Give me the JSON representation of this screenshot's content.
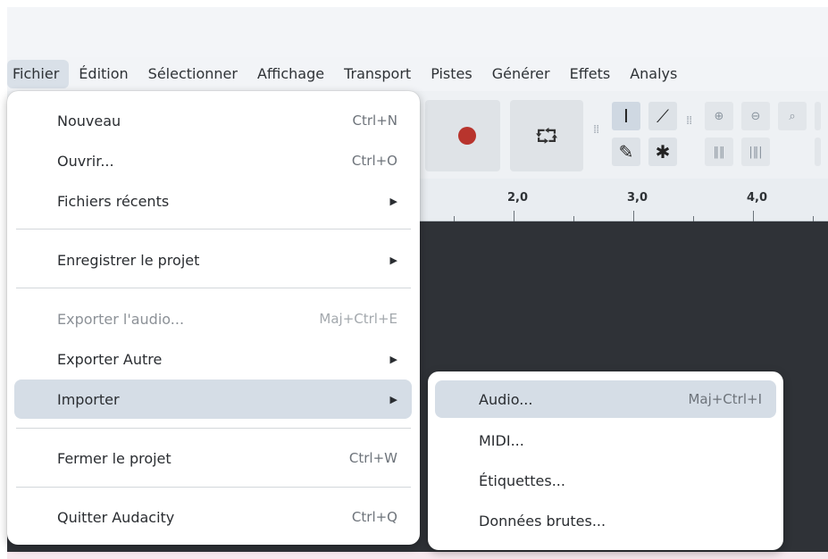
{
  "menubar": {
    "items": [
      {
        "label": "Fichier"
      },
      {
        "label": "Édition"
      },
      {
        "label": "Sélectionner"
      },
      {
        "label": "Affichage"
      },
      {
        "label": "Transport"
      },
      {
        "label": "Pistes"
      },
      {
        "label": "Générer"
      },
      {
        "label": "Effets"
      },
      {
        "label": "Analys"
      }
    ]
  },
  "toolbar": {
    "record_icon": "record-icon",
    "loop_icon": "loop-icon",
    "tools": [
      "selection-tool-icon",
      "envelope-tool-icon",
      "draw-tool-icon",
      "multi-tool-icon"
    ],
    "zoom_icons": [
      "zoom-in-icon",
      "zoom-out-icon",
      "zoom-selection-icon",
      "fit-selection-icon",
      "fit-project-icon"
    ]
  },
  "ruler": {
    "labels": [
      "2,0",
      "3,0",
      "4,0"
    ]
  },
  "file_menu": {
    "items": [
      {
        "label": "Nouveau",
        "shortcut": "Ctrl+N"
      },
      {
        "label": "Ouvrir...",
        "shortcut": "Ctrl+O"
      },
      {
        "label": "Fichiers récents",
        "submenu": true
      },
      {
        "label": "Enregistrer le projet",
        "submenu": true
      },
      {
        "label": "Exporter l'audio...",
        "shortcut": "Maj+Ctrl+E",
        "disabled": true
      },
      {
        "label": "Exporter Autre",
        "submenu": true
      },
      {
        "label": "Importer",
        "submenu": true,
        "highlighted": true
      },
      {
        "label": "Fermer le projet",
        "shortcut": "Ctrl+W"
      },
      {
        "label": "Quitter Audacity",
        "shortcut": "Ctrl+Q"
      }
    ]
  },
  "import_submenu": {
    "items": [
      {
        "label": "Audio...",
        "shortcut": "Maj+Ctrl+I",
        "highlighted": true
      },
      {
        "label": "MIDI..."
      },
      {
        "label": "Étiquettes..."
      },
      {
        "label": "Données brutes..."
      }
    ]
  },
  "colors": {
    "record": "#b8342d",
    "highlight": "#d5dde6",
    "track_bg": "#2f3237"
  }
}
